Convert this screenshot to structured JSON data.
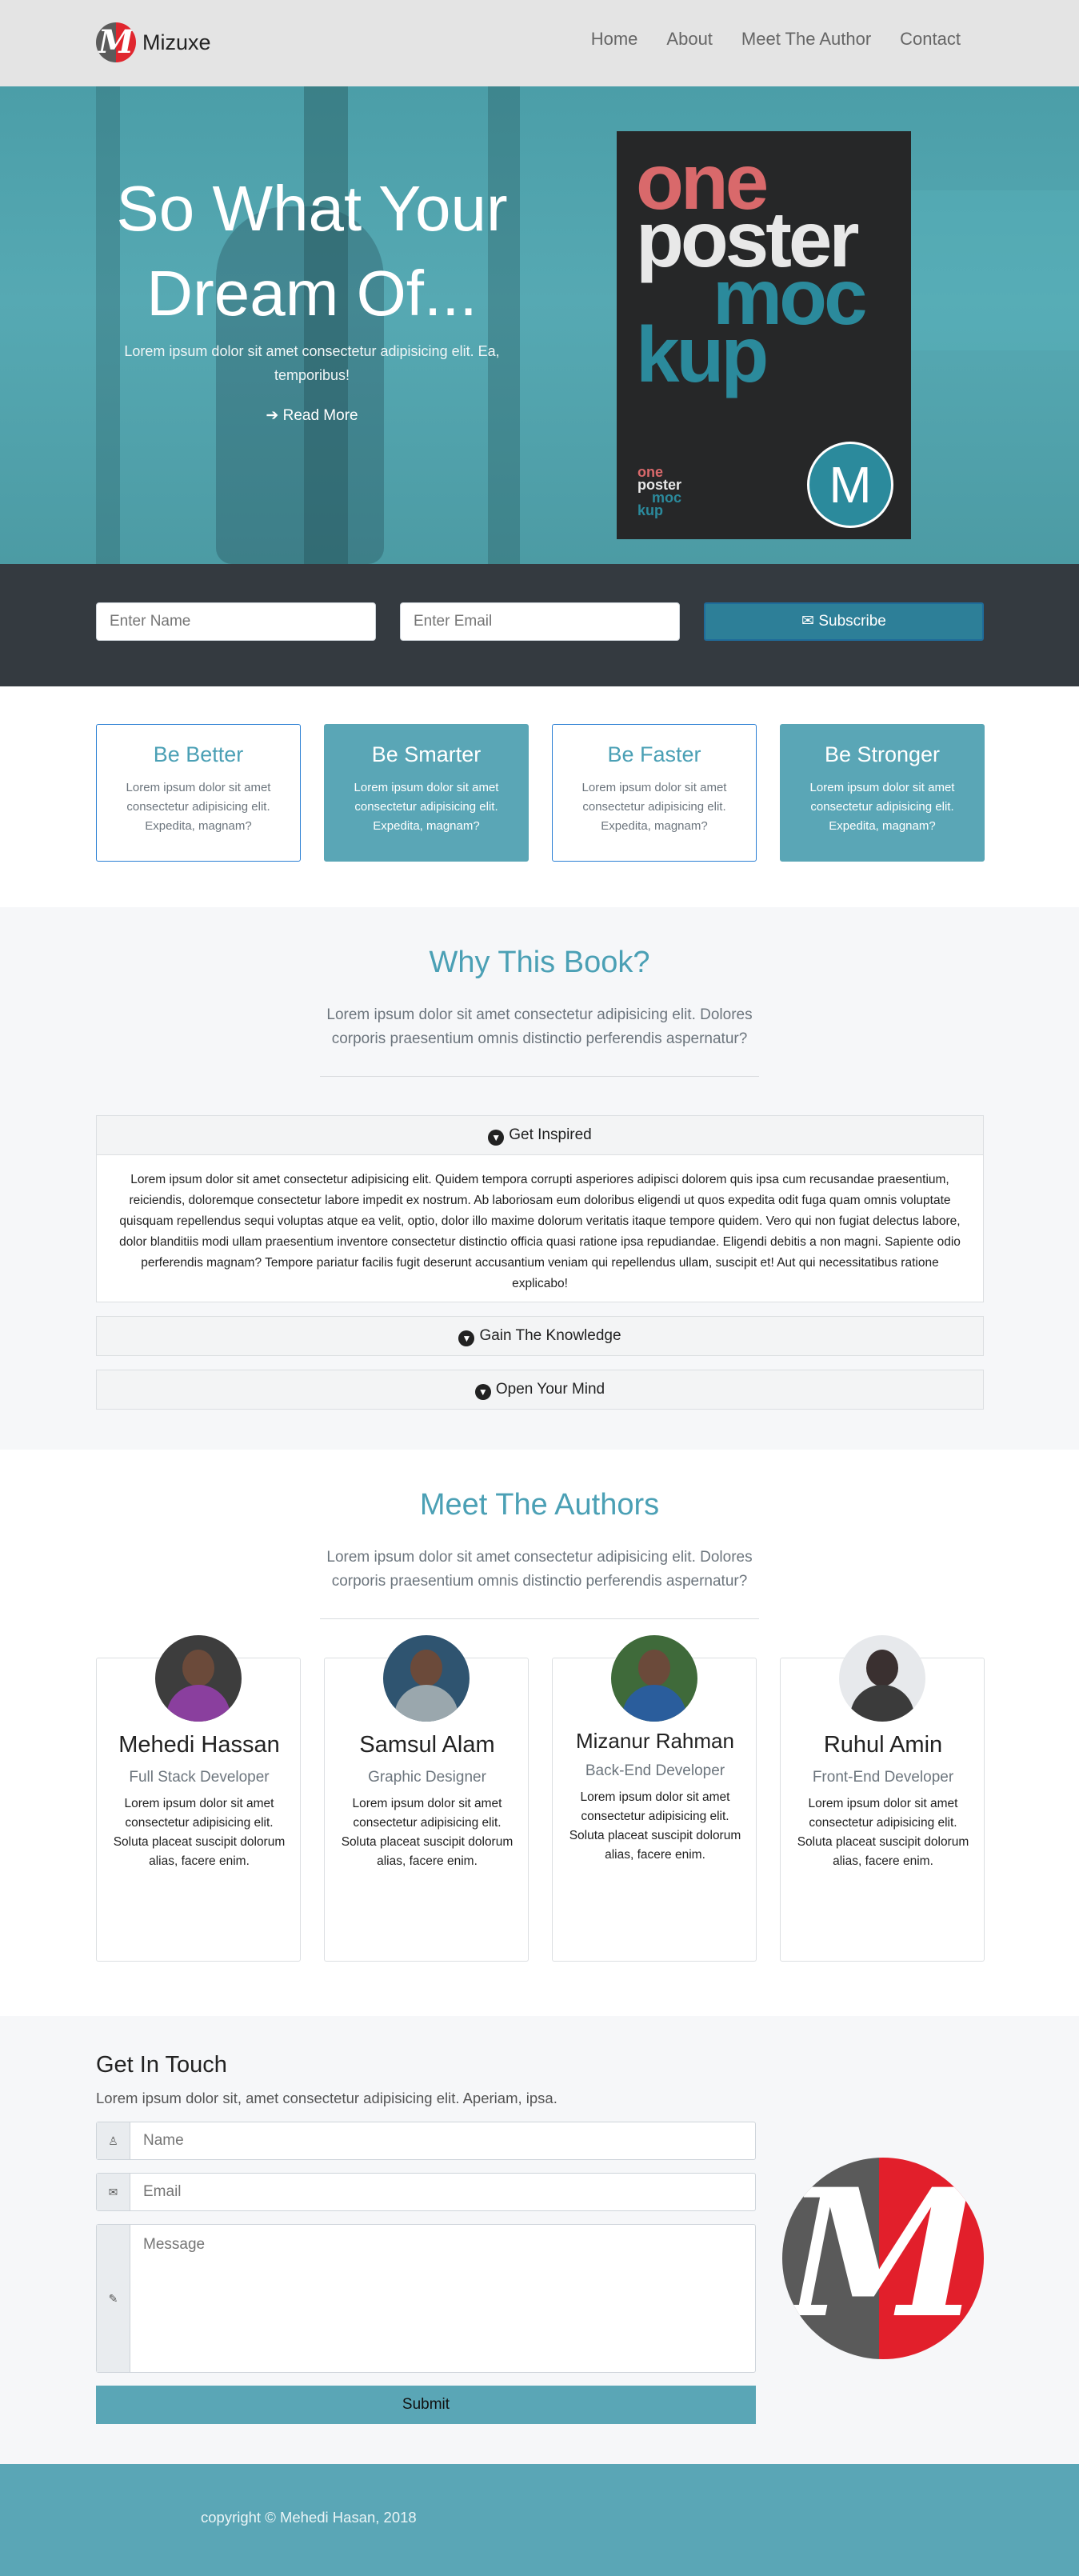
{
  "nav": {
    "brand": "Mizuxe",
    "logo_letter": "M",
    "links": [
      "Home",
      "About",
      "Meet The Author",
      "Contact"
    ]
  },
  "hero": {
    "title": "So What Your Dream Of...",
    "text": "Lorem ipsum dolor sit amet consectetur adipisicing elit. Ea, temporibus!",
    "read_more": "Read More",
    "poster": {
      "words": [
        "one",
        "poster",
        "moc",
        "kup"
      ],
      "badge": "M"
    }
  },
  "subscribe": {
    "name_placeholder": "Enter Name",
    "email_placeholder": "Enter Email",
    "button": "Subscribe"
  },
  "features": [
    {
      "title": "Be Better",
      "text": "Lorem ipsum dolor sit amet consectetur adipisicing elit. Expedita, magnam?"
    },
    {
      "title": "Be Smarter",
      "text": "Lorem ipsum dolor sit amet consectetur adipisicing elit. Expedita, magnam?"
    },
    {
      "title": "Be Faster",
      "text": "Lorem ipsum dolor sit amet consectetur adipisicing elit. Expedita, magnam?"
    },
    {
      "title": "Be Stronger",
      "text": "Lorem ipsum dolor sit amet consectetur adipisicing elit. Expedita, magnam?"
    }
  ],
  "why": {
    "title": "Why This Book?",
    "lead": "Lorem ipsum dolor sit amet consectetur adipisicing elit. Dolores corporis praesentium omnis distinctio perferendis aspernatur?",
    "accordion": [
      {
        "label": "Get Inspired",
        "body": "Lorem ipsum dolor sit amet consectetur adipisicing elit. Quidem tempora corrupti asperiores adipisci dolorem quis ipsa cum recusandae praesentium, reiciendis, doloremque consectetur labore impedit ex nostrum. Ab laboriosam eum doloribus eligendi ut quos expedita odit fuga quam omnis voluptate quisquam repellendus sequi voluptas atque ea velit, optio, dolor illo maxime dolorum veritatis itaque tempore quidem. Vero qui non fugiat delectus labore, dolor blanditiis modi ullam praesentium inventore consectetur distinctio officia quasi ratione ipsa repudiandae. Eligendi debitis a non magni. Sapiente odio perferendis magnam? Tempore pariatur facilis fugit deserunt accusantium veniam qui repellendus ullam, suscipit et! Aut qui necessitatibus ratione explicabo!"
      },
      {
        "label": "Gain The Knowledge"
      },
      {
        "label": "Open Your Mind"
      }
    ]
  },
  "authors": {
    "title": "Meet The Authors",
    "lead": "Lorem ipsum dolor sit amet consectetur adipisicing elit. Dolores corporis praesentium omnis distinctio perferendis aspernatur?",
    "people": [
      {
        "name": "Mehedi Hassan",
        "role": "Full Stack Developer",
        "text": "Lorem ipsum dolor sit amet consectetur adipisicing elit. Soluta placeat suscipit dolorum alias, facere enim."
      },
      {
        "name": "Samsul Alam",
        "role": "Graphic Designer",
        "text": "Lorem ipsum dolor sit amet consectetur adipisicing elit. Soluta placeat suscipit dolorum alias, facere enim."
      },
      {
        "name": "Mizanur Rahman",
        "role": "Back-End Developer",
        "text": "Lorem ipsum dolor sit amet consectetur adipisicing elit. Soluta placeat suscipit dolorum alias, facere enim."
      },
      {
        "name": "Ruhul Amin",
        "role": "Front-End Developer",
        "text": "Lorem ipsum dolor sit amet consectetur adipisicing elit. Soluta placeat suscipit dolorum alias, facere enim."
      }
    ]
  },
  "contact": {
    "title": "Get In Touch",
    "lead": "Lorem ipsum dolor sit, amet consectetur adipisicing elit. Aperiam, ipsa.",
    "name_placeholder": "Name",
    "email_placeholder": "Email",
    "message_placeholder": "Message",
    "submit": "Submit",
    "logo_letter": "M"
  },
  "footer": {
    "copyright": "copyright © Mehedi Hasan, 2018"
  },
  "colors": {
    "accent": "#5aa6b6",
    "subscribe_bar": "#343a40",
    "subscribe_button": "#2d7f98",
    "poster_bg": "#262728"
  }
}
